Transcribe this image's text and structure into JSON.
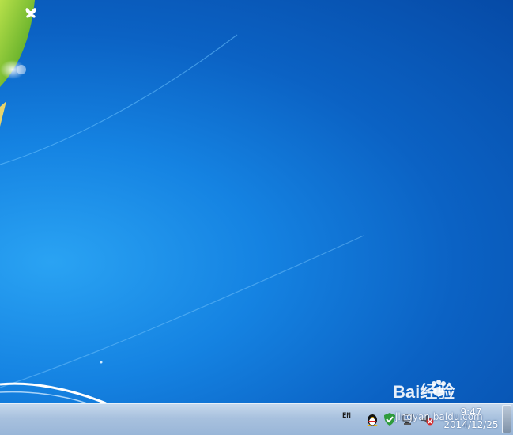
{
  "taskbar": {
    "language": "EN",
    "clock": {
      "time": "9:47",
      "date": "2014/12/25"
    }
  },
  "tray": {
    "icons": [
      "qq-penguin-icon",
      "security-shield-icon",
      "network-icon",
      "volume-muted-icon"
    ]
  },
  "watermark": {
    "brand": "Bai经验",
    "url": "jingyan.baidu.com"
  },
  "colors": {
    "desktop": "#0b62c4",
    "taskbar": "#a8c1de",
    "tray_shield": "#2e9b3b",
    "muted_x": "#d62828"
  }
}
